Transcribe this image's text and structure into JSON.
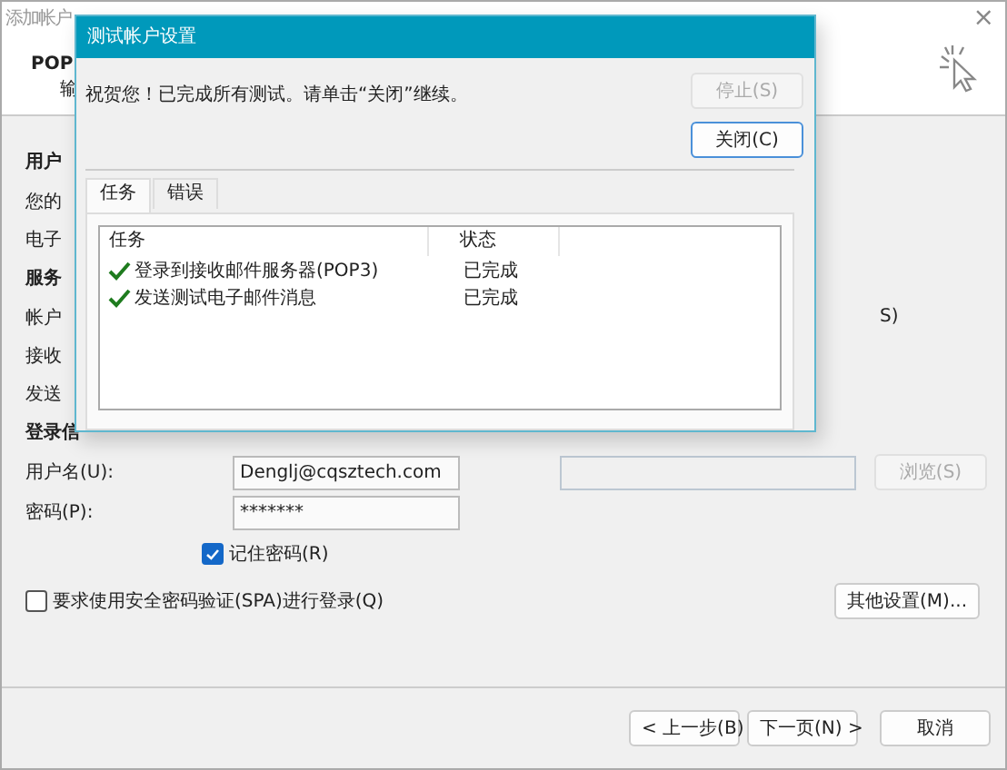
{
  "window": {
    "title": "添加帐户",
    "close": "×",
    "header": [
      "POP",
      "输"
    ]
  },
  "sections": [
    {
      "kind": "heading",
      "text": "用户"
    },
    {
      "kind": "label",
      "text": "您的"
    },
    {
      "kind": "label",
      "text": "电子"
    },
    {
      "kind": "heading",
      "text": "服务"
    },
    {
      "kind": "label",
      "text": "帐户",
      "right": "S)"
    },
    {
      "kind": "label",
      "text": "接收"
    },
    {
      "kind": "label",
      "text": "发送"
    },
    {
      "kind": "heading",
      "text": "登录信"
    }
  ],
  "login": {
    "fields": [
      {
        "label": "用户名(U):",
        "value": "Denglj@cqsztech.com"
      },
      {
        "label": "密码(P):",
        "value": "*******"
      }
    ],
    "remember": {
      "label": "记住密码(R)",
      "checked": true
    },
    "spa": {
      "label": "要求使用安全密码验证(SPA)进行登录(Q)",
      "checked": false
    }
  },
  "browse": {
    "label": "浏览(S)",
    "disabled": true
  },
  "more_settings": "其他设置(M)...",
  "footer_buttons": [
    {
      "label": "< 上一步(B)"
    },
    {
      "label": "下一页(N) >"
    },
    {
      "label": "取消"
    }
  ],
  "dialog": {
    "title": "测试帐户设置",
    "message": "祝贺您！已完成所有测试。请单击“关闭”继续。",
    "buttons": [
      {
        "label": "停止(S)",
        "disabled": true
      },
      {
        "label": "关闭(C)",
        "disabled": false
      }
    ],
    "tabs": [
      {
        "label": "任务",
        "selected": true
      },
      {
        "label": "错误",
        "selected": false
      }
    ],
    "columns": [
      "任务",
      "状态"
    ],
    "rows": [
      {
        "task": "登录到接收邮件服务器(POP3)",
        "status": "已完成",
        "done": true
      },
      {
        "task": "发送测试电子邮件消息",
        "status": "已完成",
        "done": true
      }
    ]
  }
}
